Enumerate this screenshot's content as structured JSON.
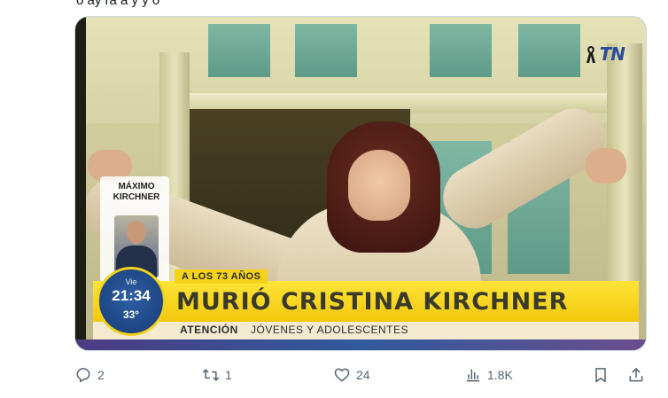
{
  "tweet": {
    "top_text_fragment": "ó ay ra a y y ó"
  },
  "media": {
    "channel_logo": "TN",
    "caption_box": {
      "name": "MÁXIMO KIRCHNER"
    },
    "clock": {
      "day": "Vie",
      "time": "21:34",
      "temperature": "33°"
    },
    "kicker": "A LOS 73 AÑOS",
    "headline": "MURIÓ CRISTINA KIRCHNER",
    "sub_label": "ATENCIÓN",
    "sub_text": "JÓVENES Y ADOLESCENTES"
  },
  "actions": {
    "reply_count": "2",
    "retweet_count": "1",
    "like_count": "24",
    "views_count": "1.8K"
  },
  "icons": {
    "reply": "reply-icon",
    "retweet": "retweet-icon",
    "like": "heart-icon",
    "views": "views-icon",
    "bookmark": "bookmark-icon",
    "share": "share-icon"
  }
}
